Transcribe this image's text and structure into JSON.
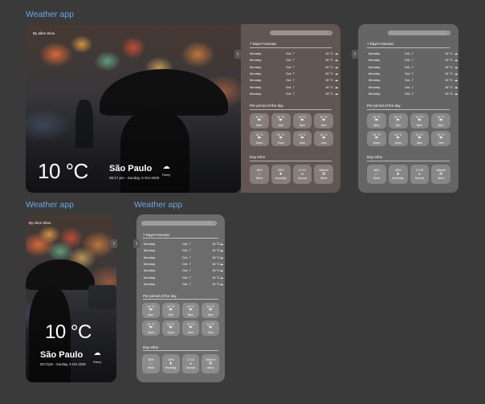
{
  "sections": {
    "top": "Weather app",
    "bottom_left": "Weather app",
    "bottom_right": "Weather app"
  },
  "hero_large": {
    "byline": "By aline Silva",
    "temperature": "10 °C",
    "city": "São Paulo",
    "datetime": "09:17 pm - Sunday, 6 Oct 2025",
    "condition": "Rainy",
    "condition_icon": "cloud-rain-icon"
  },
  "hero_small": {
    "byline": "By Alice Silva",
    "temperature": "10 °C",
    "city": "São Paulo",
    "datetime": "09:17pm - Sunday, 6 Oct 2025",
    "condition": "Rainy",
    "condition_icon": "cloud-rain-icon"
  },
  "forecast_labels": {
    "seven_days": "7 Days Forecast",
    "per_period": "Per period of the day",
    "day_infos": "Day Infos"
  },
  "forecast_a": {
    "days": [
      {
        "day": "Monday",
        "date": "Oct, 7",
        "temp": "16 °C",
        "icon": "cloud-icon"
      },
      {
        "day": "Monday",
        "date": "Oct, 7",
        "temp": "16 °C",
        "icon": "cloud-icon"
      },
      {
        "day": "Monday",
        "date": "Oct, 7",
        "temp": "16 °C",
        "icon": "cloud-icon"
      },
      {
        "day": "Monday",
        "date": "Oct, 7",
        "temp": "16 °C",
        "icon": "cloud-icon"
      },
      {
        "day": "Monday",
        "date": "Oct, 7",
        "temp": "16 °C",
        "icon": "cloud-icon"
      },
      {
        "day": "Monday",
        "date": "Oct, 7",
        "temp": "16 °C",
        "icon": "cloud-icon"
      },
      {
        "day": "Monday",
        "date": "Oct, 7",
        "temp": "16 °C",
        "icon": "cloud-icon"
      }
    ],
    "periods": [
      {
        "temp": "14 °C",
        "icon": "cloud-rain-icon",
        "time": "6pm"
      },
      {
        "temp": "14 °C",
        "icon": "cloud-rain-icon",
        "time": "7pm"
      },
      {
        "temp": "14 °C",
        "icon": "cloud-rain-icon",
        "time": "8pm"
      },
      {
        "temp": "14 °C",
        "icon": "cloud-rain-icon",
        "time": "9pm"
      },
      {
        "temp": "14 °C",
        "icon": "cloud-rain-icon",
        "time": "10pm"
      },
      {
        "temp": "14 °C",
        "icon": "cloud-rain-icon",
        "time": "11pm"
      },
      {
        "temp": "14 °C",
        "icon": "cloud-rain-icon",
        "time": "0am"
      },
      {
        "temp": "14 °C",
        "icon": "cloud-rain-icon",
        "time": "1am"
      }
    ],
    "infos": [
      {
        "value": "16%",
        "icon": "wind-icon",
        "label": "Wind"
      },
      {
        "value": "16%",
        "icon": "drop-icon",
        "label": "Humidity"
      },
      {
        "value": "17:12",
        "icon": "sunset-icon",
        "label": "Sunset"
      },
      {
        "value": "16km/h",
        "icon": "wind-speed-icon",
        "label": "Wind"
      }
    ]
  },
  "forecast_b": {
    "days": [
      {
        "day": "Monday",
        "date": "Oct, 7",
        "temp": "16 °C",
        "icon": "cloud-icon"
      },
      {
        "day": "Monday",
        "date": "Oct, 7",
        "temp": "16 °C",
        "icon": "cloud-icon"
      },
      {
        "day": "Monday",
        "date": "Oct, 7",
        "temp": "16 °C",
        "icon": "cloud-icon"
      },
      {
        "day": "Monday",
        "date": "Oct, 7",
        "temp": "16 °C",
        "icon": "cloud-icon"
      },
      {
        "day": "Monday",
        "date": "Oct, 7",
        "temp": "16 °C",
        "icon": "cloud-icon"
      },
      {
        "day": "Monday",
        "date": "Oct, 7",
        "temp": "16 °C",
        "icon": "cloud-icon"
      },
      {
        "day": "Monday",
        "date": "Oct, 7",
        "temp": "16 °C",
        "icon": "cloud-icon"
      }
    ],
    "periods": [
      {
        "temp": "14 °C",
        "icon": "cloud-rain-icon",
        "time": "6pm"
      },
      {
        "temp": "14 °C",
        "icon": "cloud-rain-icon",
        "time": "7pm"
      },
      {
        "temp": "14 °C",
        "icon": "cloud-rain-icon",
        "time": "8pm"
      },
      {
        "temp": "14 °C",
        "icon": "cloud-rain-icon",
        "time": "9pm"
      },
      {
        "temp": "14 °C",
        "icon": "cloud-rain-icon",
        "time": "10pm"
      },
      {
        "temp": "14 °C",
        "icon": "cloud-rain-icon",
        "time": "11pm"
      },
      {
        "temp": "14 °C",
        "icon": "cloud-rain-icon",
        "time": "0am"
      },
      {
        "temp": "14 °C",
        "icon": "cloud-rain-icon",
        "time": "1am"
      }
    ],
    "infos": [
      {
        "value": "16%",
        "icon": "wind-icon",
        "label": "Wind"
      },
      {
        "value": "16%",
        "icon": "drop-icon",
        "label": "Humidity"
      },
      {
        "value": "17:12",
        "icon": "sunset-icon",
        "label": "Sunset"
      },
      {
        "value": "16km/h",
        "icon": "wind-speed-icon",
        "label": "Wind"
      }
    ]
  },
  "forecast_c": {
    "days": [
      {
        "day": "Monday",
        "date": "Oct, 7",
        "temp": "16 °C",
        "icon": "cloud-icon"
      },
      {
        "day": "Monday",
        "date": "Oct, 7",
        "temp": "16 °C",
        "icon": "cloud-icon"
      },
      {
        "day": "Monday",
        "date": "Oct, 7",
        "temp": "16 °C",
        "icon": "cloud-icon"
      },
      {
        "day": "Monday",
        "date": "Oct, 7",
        "temp": "16 °C",
        "icon": "cloud-icon"
      },
      {
        "day": "Monday",
        "date": "Oct, 7",
        "temp": "16 °C",
        "icon": "cloud-icon"
      },
      {
        "day": "Monday",
        "date": "Oct, 7",
        "temp": "16 °C",
        "icon": "cloud-icon"
      },
      {
        "day": "Monday",
        "date": "Oct, 7",
        "temp": "16 °C",
        "icon": "cloud-icon"
      }
    ],
    "periods": [
      {
        "temp": "14 °C",
        "icon": "cloud-rain-icon",
        "time": "6pm"
      },
      {
        "temp": "14 °C",
        "icon": "cloud-rain-icon",
        "time": "7pm"
      },
      {
        "temp": "14 °C",
        "icon": "cloud-rain-icon",
        "time": "8pm"
      },
      {
        "temp": "14 °C",
        "icon": "cloud-rain-icon",
        "time": "9pm"
      },
      {
        "temp": "14 °C",
        "icon": "cloud-rain-icon",
        "time": "10pm"
      },
      {
        "temp": "14 °C",
        "icon": "cloud-rain-icon",
        "time": "11pm"
      },
      {
        "temp": "14 °C",
        "icon": "cloud-rain-icon",
        "time": "0am"
      },
      {
        "temp": "14 °C",
        "icon": "cloud-rain-icon",
        "time": "1am"
      }
    ],
    "infos": [
      {
        "value": "16%",
        "icon": "wind-icon",
        "label": "Wind"
      },
      {
        "value": "16%",
        "icon": "drop-icon",
        "label": "Humidity"
      },
      {
        "value": "17:12",
        "icon": "sunset-icon",
        "label": "Sunset"
      },
      {
        "value": "16km/h",
        "icon": "wind-speed-icon",
        "label": "Wind"
      }
    ]
  },
  "nav": {
    "next_arrow": "›",
    "prev_arrow": "‹"
  },
  "colors": {
    "background": "#3a3a3a",
    "section_title": "#6aa6e8",
    "glass_panel": "#787878"
  }
}
